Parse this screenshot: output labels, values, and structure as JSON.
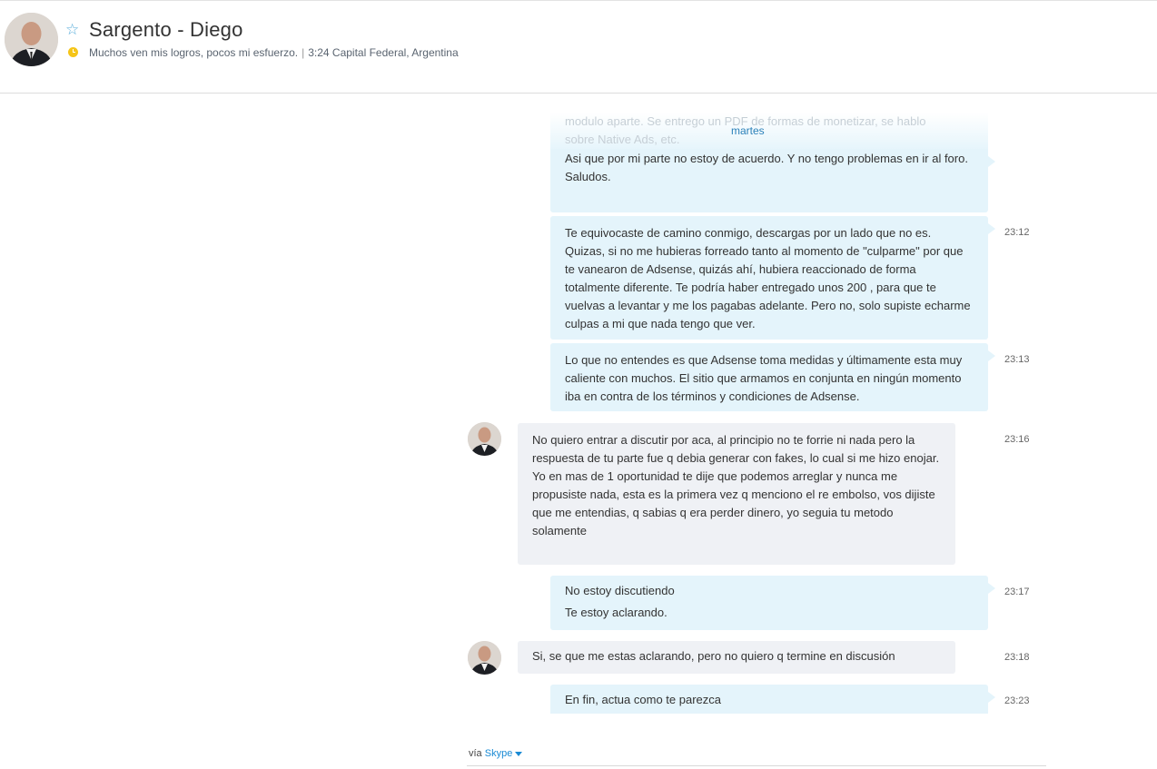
{
  "header": {
    "contact_name": "Sargento - Diego",
    "mood": "Muchos ven mis logros, pocos mi esfuerzo.",
    "separator": "|",
    "local_info": "3:24 Capital Federal, Argentina",
    "icons": {
      "favorite": "star-outline-icon",
      "time": "clock-icon"
    }
  },
  "chat": {
    "day_separator": "martes",
    "faded_text": [
      "modulo aparte. Se entrego un PDF de formas de monetizar, se hablo",
      "sobre Native Ads, etc."
    ],
    "messages": [
      {
        "direction": "out",
        "time": "",
        "lines": [
          "Asi que por mi parte no estoy de acuerdo. Y no tengo problemas en ir al foro.",
          "Saludos."
        ]
      },
      {
        "direction": "out",
        "time": "23:12",
        "lines": [
          "Te equivocaste de camino conmigo, descargas por un lado que no es. Quizas, si no me hubieras forreado tanto al momento de \"culparme\" por que te vanearon de Adsense, quizás ahí, hubiera reaccionado de forma totalmente diferente. Te podría haber entregado unos 200 , para que te vuelvas a levantar y me los pagabas adelante. Pero no, solo supiste echarme culpas a mi que nada tengo que ver."
        ]
      },
      {
        "direction": "out",
        "time": "23:13",
        "lines": [
          "Lo que no entendes es que Adsense toma medidas y últimamente esta muy caliente con muchos. El sitio que armamos en conjunta en ningún momento iba en contra de los términos y condiciones de Adsense."
        ]
      },
      {
        "direction": "in",
        "time": "23:16",
        "lines": [
          "No quiero entrar a discutir por aca, al principio no te forrie ni nada pero la respuesta de tu parte fue q debia generar con fakes, lo cual si me hizo enojar.",
          "Yo en mas de 1 oportunidad te dije que podemos arreglar y nunca me propusiste nada, esta es la primera vez q menciono el re embolso, vos dijiste que me entendias, q sabias q era perder dinero, yo seguia tu metodo solamente"
        ]
      },
      {
        "direction": "out",
        "time": "23:17",
        "lines": [
          "No estoy discutiendo",
          "Te estoy aclarando."
        ]
      },
      {
        "direction": "in",
        "time": "23:18",
        "lines": [
          "Si, se que me estas aclarando, pero no quiero q termine en discusión"
        ]
      },
      {
        "direction": "out",
        "time": "23:23",
        "lines": [
          "En fin, actua como te parezca"
        ]
      }
    ]
  },
  "footer": {
    "via_label": "vía",
    "service": "Skype"
  }
}
